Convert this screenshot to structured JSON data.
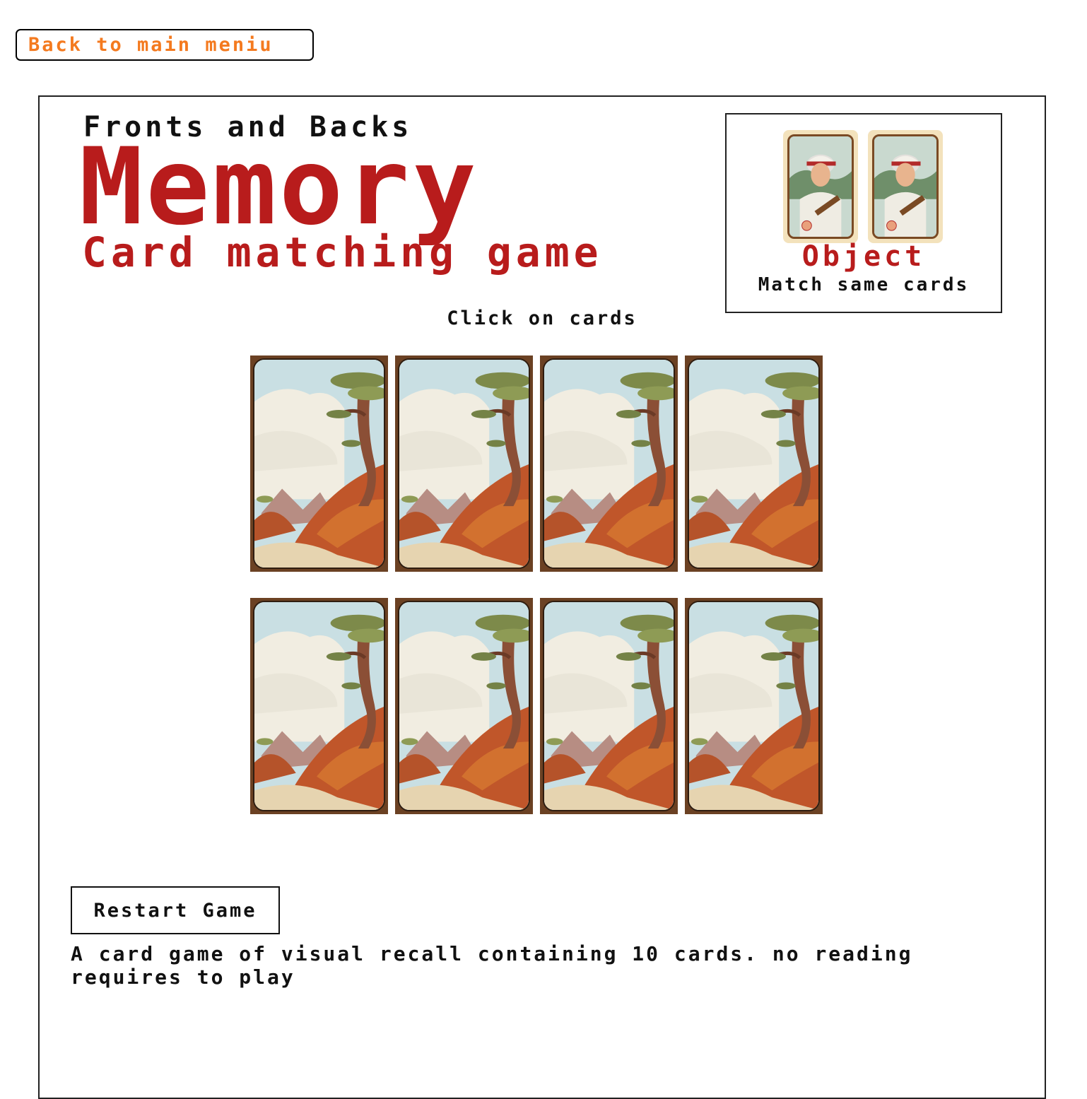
{
  "nav": {
    "back_label": "Back to main meniu"
  },
  "header": {
    "kicker": "Fronts and Backs",
    "title": "Memory",
    "subtitle": "Card matching game"
  },
  "objective": {
    "label": "Object",
    "description": "Match same cards",
    "example_cards": [
      {
        "icon": "baseball-player-card-icon"
      },
      {
        "icon": "baseball-player-card-icon"
      }
    ]
  },
  "board": {
    "instruction": "Click on cards",
    "cards": [
      {
        "state": "face-down",
        "icon": "landscape-card-back-icon"
      },
      {
        "state": "face-down",
        "icon": "landscape-card-back-icon"
      },
      {
        "state": "face-down",
        "icon": "landscape-card-back-icon"
      },
      {
        "state": "face-down",
        "icon": "landscape-card-back-icon"
      },
      {
        "state": "face-down",
        "icon": "landscape-card-back-icon"
      },
      {
        "state": "face-down",
        "icon": "landscape-card-back-icon"
      },
      {
        "state": "face-down",
        "icon": "landscape-card-back-icon"
      },
      {
        "state": "face-down",
        "icon": "landscape-card-back-icon"
      }
    ]
  },
  "controls": {
    "restart_label": "Restart Game"
  },
  "footer": {
    "description": "A card game of visual recall containing 10 cards. no reading requires to play"
  },
  "colors": {
    "accent_red": "#b81c1c",
    "back_link_orange": "#f47a1f",
    "card_frame_brown": "#6b4123"
  }
}
